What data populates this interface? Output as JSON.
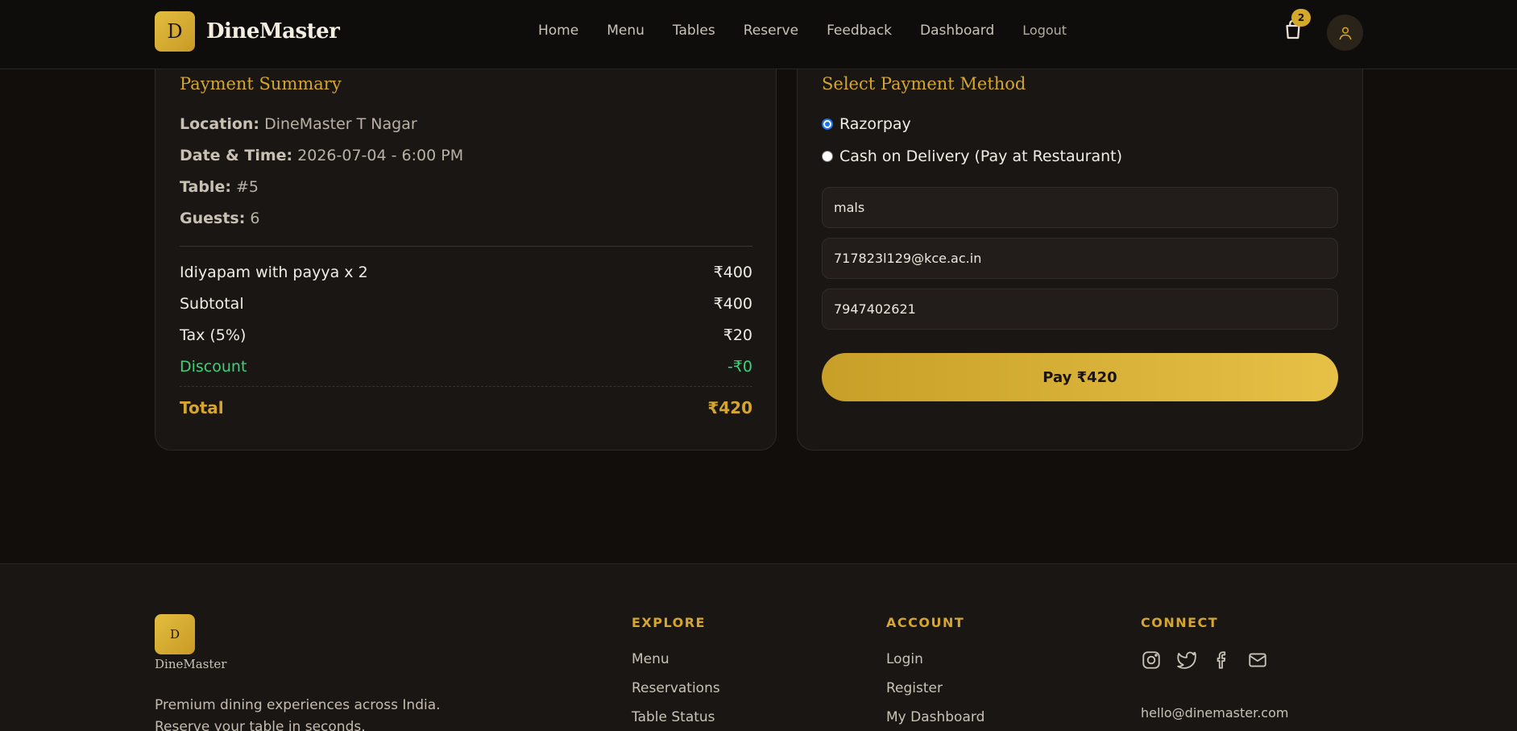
{
  "brand": {
    "initial": "D",
    "name": "DineMaster"
  },
  "nav": {
    "links": [
      "Home",
      "Menu",
      "Tables",
      "Reserve",
      "Feedback",
      "Dashboard",
      "Logout"
    ],
    "cart_count": "2"
  },
  "summary": {
    "title": "Payment Summary",
    "location_label": "Location:",
    "location_value": "DineMaster T Nagar",
    "datetime_label": "Date & Time:",
    "datetime_value": "2026-07-04 - 6:00 PM",
    "table_label": "Table:",
    "table_value": "#5",
    "guests_label": "Guests:",
    "guests_value": "6",
    "items": [
      {
        "name": "Idiyapam with payya x 2",
        "amount": "₹400"
      }
    ],
    "subtotal_label": "Subtotal",
    "subtotal_value": "₹400",
    "tax_label": "Tax (5%)",
    "tax_value": "₹20",
    "discount_label": "Discount",
    "discount_value": "-₹0",
    "total_label": "Total",
    "total_value": "₹420"
  },
  "payment": {
    "title": "Select Payment Method",
    "options": [
      {
        "label": "Razorpay",
        "selected": true
      },
      {
        "label": "Cash on Delivery (Pay at Restaurant)",
        "selected": false
      }
    ],
    "name_value": "mals",
    "email_value": "717823l129@kce.ac.in",
    "phone_value": "7947402621",
    "pay_button": "Pay ₹420"
  },
  "footer": {
    "brand_initial": "D",
    "brand_name": "DineMaster",
    "tagline_1": "Premium dining experiences across India.",
    "tagline_2": "Reserve your table in seconds.",
    "explore": {
      "heading": "EXPLORE",
      "links": [
        "Menu",
        "Reservations",
        "Table Status"
      ]
    },
    "account": {
      "heading": "ACCOUNT",
      "links": [
        "Login",
        "Register",
        "My Dashboard"
      ]
    },
    "connect": {
      "heading": "CONNECT",
      "icons": [
        "instagram-icon",
        "twitter-icon",
        "facebook-icon",
        "mail-icon"
      ],
      "email": "hello@dinemaster.com"
    }
  },
  "colors": {
    "accent": "#d4a62f",
    "background": "#110e0c",
    "card": "#1a1614",
    "discount": "#3fd07a"
  }
}
